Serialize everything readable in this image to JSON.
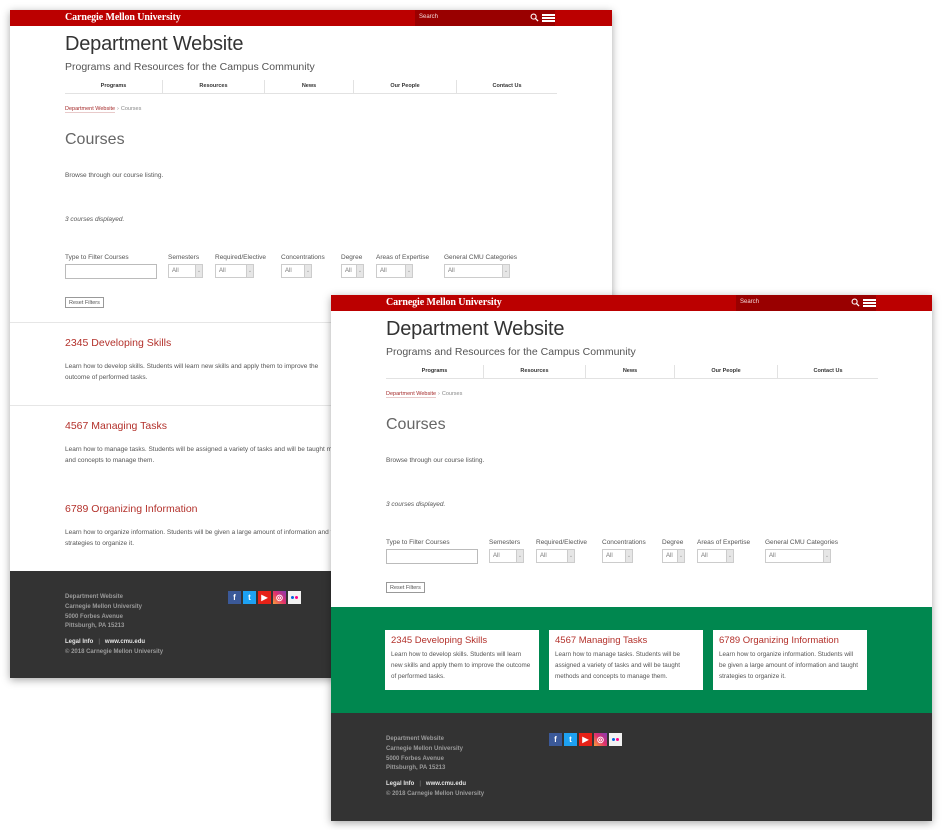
{
  "brand": {
    "name": "Carnegie Mellon University",
    "primary_color": "#bb0000",
    "search_bg_color": "#990000",
    "card_band_color": "#00874f",
    "footer_color": "#333333",
    "link_color": "#b3312b"
  },
  "header": {
    "search_placeholder": "Search",
    "site_title": "Department Website",
    "site_subtitle": "Programs and Resources for the Campus Community"
  },
  "nav": {
    "items": [
      {
        "label": "Programs"
      },
      {
        "label": "Resources"
      },
      {
        "label": "News"
      },
      {
        "label": "Our People"
      },
      {
        "label": "Contact Us"
      }
    ]
  },
  "breadcrumb": {
    "home": "Department Website",
    "separator": "›",
    "current": "Courses"
  },
  "page": {
    "heading": "Courses",
    "intro": "Browse through our course listing.",
    "count_text": "3 courses displayed."
  },
  "filters": {
    "text_filter_label": "Type to Filter Courses",
    "text_filter_value": "",
    "selects": [
      {
        "label": "Semesters",
        "value": "All"
      },
      {
        "label": "Required/Elective",
        "value": "All"
      },
      {
        "label": "Concentrations",
        "value": "All"
      },
      {
        "label": "Degree",
        "value": "All"
      },
      {
        "label": "Areas of Expertise",
        "value": "All"
      },
      {
        "label": "General CMU Categories",
        "value": "All"
      }
    ],
    "reset_label": "Reset Filters"
  },
  "courses": [
    {
      "title": "2345 Developing Skills",
      "description": "Learn how to develop skills. Students will learn new skills and apply them to improve the outcome of performed tasks."
    },
    {
      "title": "4567 Managing Tasks",
      "description": "Learn how to manage tasks. Students will be assigned a variety of tasks and will be taught methods and concepts to manage them."
    },
    {
      "title": "6789 Organizing Information",
      "description": "Learn how to organize information. Students will be given a large amount of information and taught strategies to organize it."
    }
  ],
  "footer": {
    "address_lines": [
      "Department Website",
      "Carnegie Mellon University",
      "5000 Forbes Avenue",
      "Pittsburgh, PA 15213"
    ],
    "legal_label": "Legal Info",
    "link_separator": "|",
    "site_link": "www.cmu.edu",
    "copyright": "© 2018 Carnegie Mellon University",
    "socials": [
      {
        "name": "facebook",
        "glyph": "f"
      },
      {
        "name": "twitter",
        "glyph": "t"
      },
      {
        "name": "youtube",
        "glyph": "▶"
      },
      {
        "name": "instagram",
        "glyph": "◎"
      },
      {
        "name": "flickr",
        "glyph": ""
      }
    ]
  }
}
